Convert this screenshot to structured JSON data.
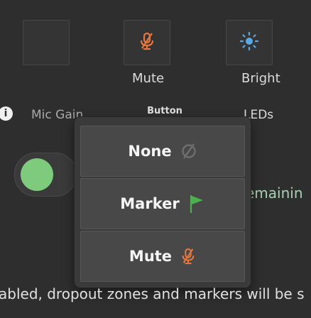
{
  "tiles": [
    {
      "label": "",
      "icon": "empty"
    },
    {
      "label": "Mute",
      "icon": "mic-muted-icon"
    },
    {
      "label": "Bright",
      "icon": "brightness-icon"
    }
  ],
  "fields": {
    "info_icon": "i",
    "mic_gain_label": "Mic Gain",
    "leds_label": "LEDs",
    "remaining_text": "emainin"
  },
  "popup": {
    "title": "Button",
    "options": [
      {
        "label": "None",
        "icon": "no-symbol-icon"
      },
      {
        "label": "Marker",
        "icon": "flag-icon"
      },
      {
        "label": "Mute",
        "icon": "mic-muted-icon"
      }
    ]
  },
  "bottom_text": "abled, dropout zones and markers will be s",
  "colors": {
    "accent_orange": "#e8773d",
    "flag_green": "#4caf50",
    "toggle_green": "#7ecb7e",
    "brightness_blue": "#5aa9e6"
  }
}
